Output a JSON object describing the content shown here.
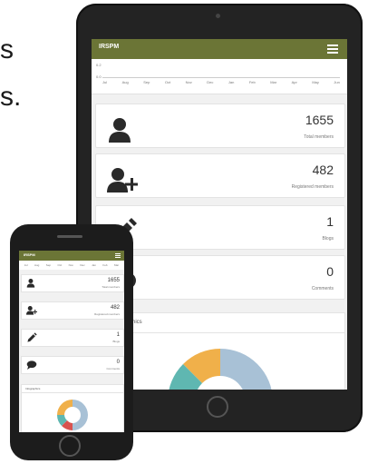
{
  "background_text": {
    "line1": "s",
    "line2": "s."
  },
  "tablet": {
    "brand": "IRSPM",
    "chart_axis": {
      "months": [
        "Jul",
        "Aug",
        "Sep",
        "Oct",
        "Nov",
        "Dec",
        "Jan",
        "Feb",
        "Mar",
        "Apr",
        "May",
        "Jun"
      ],
      "y_labels": [
        "0.2",
        "0.0"
      ]
    },
    "stats": [
      {
        "value": "1655",
        "label": "Total members",
        "icon": "user-icon"
      },
      {
        "value": "482",
        "label": "Registered members",
        "icon": "user-add-icon"
      },
      {
        "value": "1",
        "label": "Blogs",
        "icon": "pencil-icon"
      },
      {
        "value": "0",
        "label": "Comments",
        "icon": "comment-icon"
      }
    ],
    "graph_title": "Infographics"
  },
  "phone": {
    "brand": "IRSPM",
    "stats": [
      {
        "value": "1655",
        "label": "Total members",
        "icon": "user-icon"
      },
      {
        "value": "482",
        "label": "Registered members",
        "icon": "user-add-icon"
      },
      {
        "value": "1",
        "label": "Blogs",
        "icon": "pencil-icon"
      },
      {
        "value": "0",
        "label": "Comments",
        "icon": "comment-icon"
      }
    ],
    "graph_title": "Infographics"
  },
  "colors": {
    "navbar": "#6b7536",
    "donut_blue": "#a8c1d6",
    "donut_teal": "#5fb7b1",
    "donut_orange": "#f0b04a",
    "donut_red": "#d9534f"
  }
}
